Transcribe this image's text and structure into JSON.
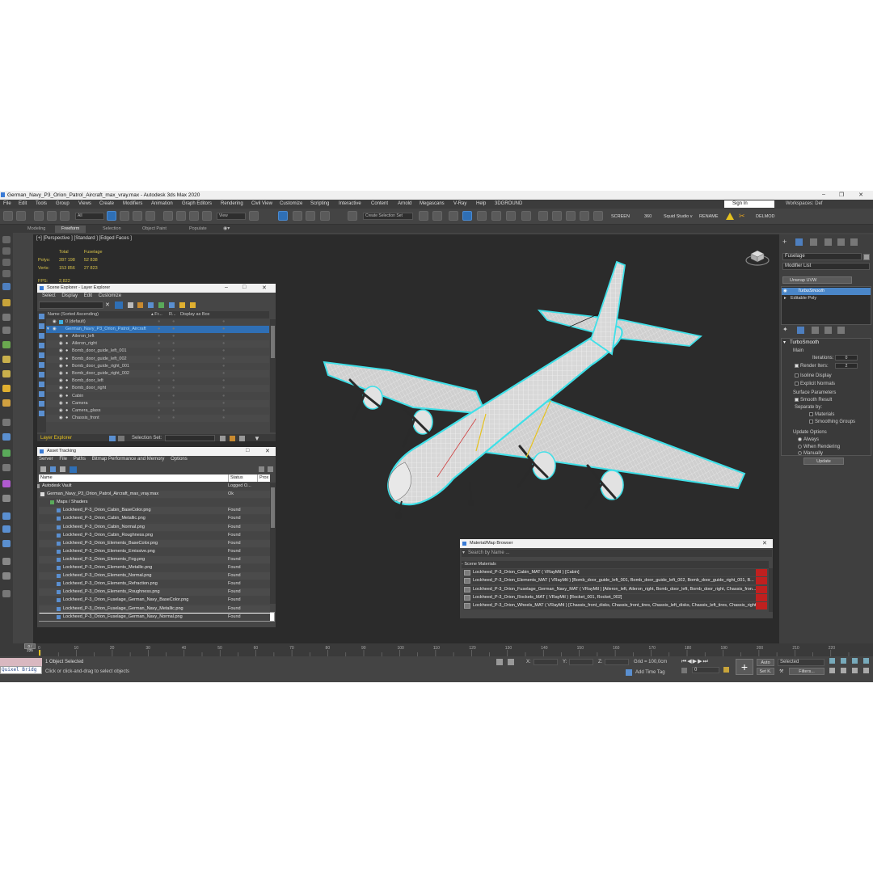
{
  "window": {
    "title": "German_Navy_P3_Orion_Patrol_Aircraft_max_vray.max - Autodesk 3ds Max 2020"
  },
  "menu": [
    "File",
    "Edit",
    "Tools",
    "Group",
    "Views",
    "Create",
    "Modifiers",
    "Animation",
    "Graph Editors",
    "Rendering",
    "Civil View",
    "Customize",
    "Scripting",
    "Interactive",
    "Content",
    "Arnold",
    "Megascans",
    "V-Ray",
    "Help",
    "3DGROUND"
  ],
  "account": {
    "sign_in": "Sign In",
    "workspaces_label": "Workspaces:",
    "workspace": "Def"
  },
  "toolbar": {
    "filter": "All",
    "view": "View",
    "selection_set": "Create Selection Set",
    "screen": "SCREEN",
    "fps": "360",
    "squid": "Squid Studio v",
    "rename": "RENAME",
    "delmod": "DELMOD"
  },
  "ribbon": {
    "tabs": [
      "Modeling",
      "Freeform",
      "Selection",
      "Object Paint",
      "Populate"
    ]
  },
  "viewport": {
    "label": "[+] [Perspective ] [Standard ] [Edged Faces ]",
    "stats": {
      "col_total": "Total",
      "col_fuselage": "Fuselage",
      "polys_label": "Polys:",
      "polys_total": "287 198",
      "polys_fuselage": "52 838",
      "verts_label": "Verts:",
      "verts_total": "153 856",
      "verts_fuselage": "27 823",
      "fps_label": "FPS:",
      "fps_value": "2,822"
    }
  },
  "scene_explorer": {
    "title": "Scene Explorer - Layer Explorer",
    "menu": [
      "Select",
      "Display",
      "Edit",
      "Customize"
    ],
    "columns": [
      "Name (Sorted Ascending)",
      "▴ Fr...",
      "R...",
      "Display as Box"
    ],
    "layer_default": "0 (default)",
    "layer_main": "German_Navy_P3_Orion_Patrol_Aircraft",
    "items": [
      "Aileron_left",
      "Aileron_right",
      "Bomb_door_guide_left_001",
      "Bomb_door_guide_left_002",
      "Bomb_door_guide_right_001",
      "Bomb_door_guide_right_002",
      "Bomb_door_left",
      "Bomb_door_right",
      "Cabin",
      "Camera",
      "Camera_glass",
      "Chassis_front"
    ],
    "footer_label": "Layer Explorer",
    "footer_selset": "Selection Set:"
  },
  "asset_tracking": {
    "title": "Asset Tracking",
    "menu": [
      "Server",
      "File",
      "Paths",
      "Bitmap Performance and Memory",
      "Options"
    ],
    "columns": [
      "Name",
      "Status",
      "Prox"
    ],
    "rows": [
      {
        "name": "Autodesk Vault",
        "status": "Logged O..."
      },
      {
        "name": "German_Navy_P3_Orion_Patrol_Aircraft_max_vray.max",
        "status": "Ok"
      },
      {
        "name": "Maps / Shaders",
        "status": ""
      },
      {
        "name": "Lockheed_P-3_Orion_Cabin_BaseColor.png",
        "status": "Found"
      },
      {
        "name": "Lockheed_P-3_Orion_Cabin_Metallic.png",
        "status": "Found"
      },
      {
        "name": "Lockheed_P-3_Orion_Cabin_Normal.png",
        "status": "Found"
      },
      {
        "name": "Lockheed_P-3_Orion_Cabin_Roughness.png",
        "status": "Found"
      },
      {
        "name": "Lockheed_P-3_Orion_Elements_BaseColor.png",
        "status": "Found"
      },
      {
        "name": "Lockheed_P-3_Orion_Elements_Emissive.png",
        "status": "Found"
      },
      {
        "name": "Lockheed_P-3_Orion_Elements_Fog.png",
        "status": "Found"
      },
      {
        "name": "Lockheed_P-3_Orion_Elements_Metallic.png",
        "status": "Found"
      },
      {
        "name": "Lockheed_P-3_Orion_Elements_Normal.png",
        "status": "Found"
      },
      {
        "name": "Lockheed_P-3_Orion_Elements_Refraction.png",
        "status": "Found"
      },
      {
        "name": "Lockheed_P-3_Orion_Elements_Roughness.png",
        "status": "Found"
      },
      {
        "name": "Lockheed_P-3_Orion_Fuselage_German_Navy_BaseColor.png",
        "status": "Found"
      },
      {
        "name": "Lockheed_P-3_Orion_Fuselage_German_Navy_Metallic.png",
        "status": "Found"
      },
      {
        "name": "Lockheed_P-3_Orion_Fuselage_German_Navy_Normal.png",
        "status": "Found"
      }
    ]
  },
  "material_browser": {
    "title": "Material/Map Browser",
    "search": "Search by Name ...",
    "section": "- Scene Materials",
    "rows": [
      "Lockheed_P-3_Orion_Cabin_MAT  ( VRayMtl ) [Cabin]",
      "Lockheed_P-3_Orion_Elements_MAT  ( VRayMtl )  [Bomb_door_guide_left_001, Bomb_door_guide_left_002, Bomb_door_guide_right_001, B...",
      "Lockheed_P-3_Orion_Fuselage_German_Navy_MAT  ( VRayMtl )  [Aileron_left, Aileron_right, Bomb_door_left, Bomb_door_right, Chassis_fron...",
      "Lockheed_P-3_Orion_Rockets_MAT  ( VRayMtl ) [Rocket_001, Rocket_002]",
      "Lockheed_P-3_Orion_Wheels_MAT  ( VRayMtl )  [Chassis_front_disks, Chassis_front_tires, Chassis_left_disks, Chassis_left_tires, Chassis_right..."
    ]
  },
  "command_panel": {
    "object_name": "Fuselage",
    "modifier_list": "Modifier List",
    "unwrap": "Unwrap UVW",
    "stack": [
      "TurboSmooth",
      "Editable Poly"
    ],
    "rollout": "TurboSmooth",
    "main": "Main",
    "iterations_label": "Iterations:",
    "iterations": "0",
    "render_iters_label": "Render Iters:",
    "render_iters": "2",
    "isoline": "Isoline Display",
    "explicit": "Explicit Normals",
    "surface_params": "Surface Parameters",
    "smooth_result": "Smooth Result",
    "separate_by": "Separate by:",
    "materials": "Materials",
    "smoothing_groups": "Smoothing Groups",
    "update_options": "Update Options",
    "always": "Always",
    "when_rendering": "When Rendering",
    "manually": "Manually",
    "update_btn": "Update"
  },
  "timeline": {
    "frame": "0 / 225",
    "ticks": [
      "0",
      "10",
      "20",
      "30",
      "40",
      "50",
      "60",
      "70",
      "80",
      "90",
      "100",
      "110",
      "120",
      "130",
      "140",
      "150",
      "160",
      "170",
      "180",
      "190",
      "200",
      "210",
      "220"
    ]
  },
  "status": {
    "selected": "1 Object Selected",
    "prompt": "Click or click-and-drag to select objects",
    "x_label": "X:",
    "y_label": "Y:",
    "z_label": "Z:",
    "grid": "Grid = 100,0cm",
    "add_time_tag": "Add Time Tag",
    "auto": "Auto",
    "set_k": "Set K.",
    "selected_dd": "Selected",
    "filters": "Filters...",
    "frame": "0",
    "maxscript": "Quixel Bridg"
  },
  "colors": {
    "accent": "#2f6fb5",
    "selection_wire": "#3fe0e8",
    "wire": "#ffffff",
    "stats": "#d8c24a"
  }
}
